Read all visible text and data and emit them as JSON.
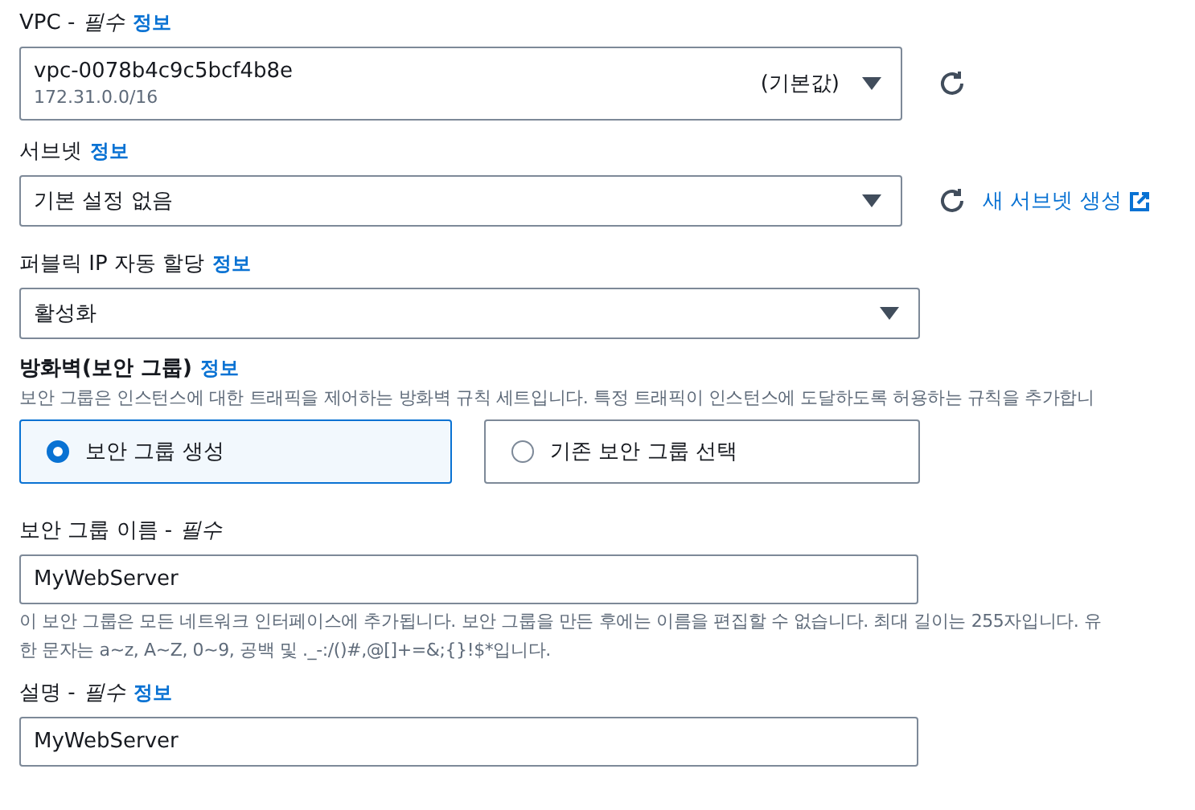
{
  "vpc": {
    "label": "VPC -",
    "required": "필수",
    "info": "정보",
    "value": "vpc-0078b4c9c5bcf4b8e",
    "secondary": "172.31.0.0/16",
    "tag": "(기본값)"
  },
  "subnet": {
    "label": "서브넷",
    "info": "정보",
    "value": "기본 설정 없음",
    "create_link": "새 서브넷 생성"
  },
  "public_ip": {
    "label": "퍼블릭 IP 자동 할당",
    "info": "정보",
    "value": "활성화"
  },
  "firewall": {
    "label": "방화벽(보안 그룹)",
    "info": "정보",
    "description": "보안 그룹은 인스턴스에 대한 트래픽을 제어하는 방화벽 규칙 세트입니다. 특정 트래픽이 인스턴스에 도달하도록 허용하는 규칙을 추가합니",
    "options": [
      {
        "label": "보안 그룹 생성",
        "selected": true
      },
      {
        "label": "기존 보안 그룹 선택",
        "selected": false
      }
    ]
  },
  "group_name": {
    "label": "보안 그룹 이름 -",
    "required": "필수",
    "value": "MyWebServer",
    "help": [
      "이 보안 그룹은 모든 네트워크 인터페이스에 추가됩니다. 보안 그룹을 만든 후에는 이름을 편집할 수 없습니다. 최대 길이는 255자입니다. 유",
      "한 문자는 a~z, A~Z, 0~9, 공백 및 ._-:/()#,@[]+=&;{}!$*입니다."
    ]
  },
  "description": {
    "label": "설명 -",
    "required": "필수",
    "info": "정보",
    "value": "MyWebServer"
  }
}
